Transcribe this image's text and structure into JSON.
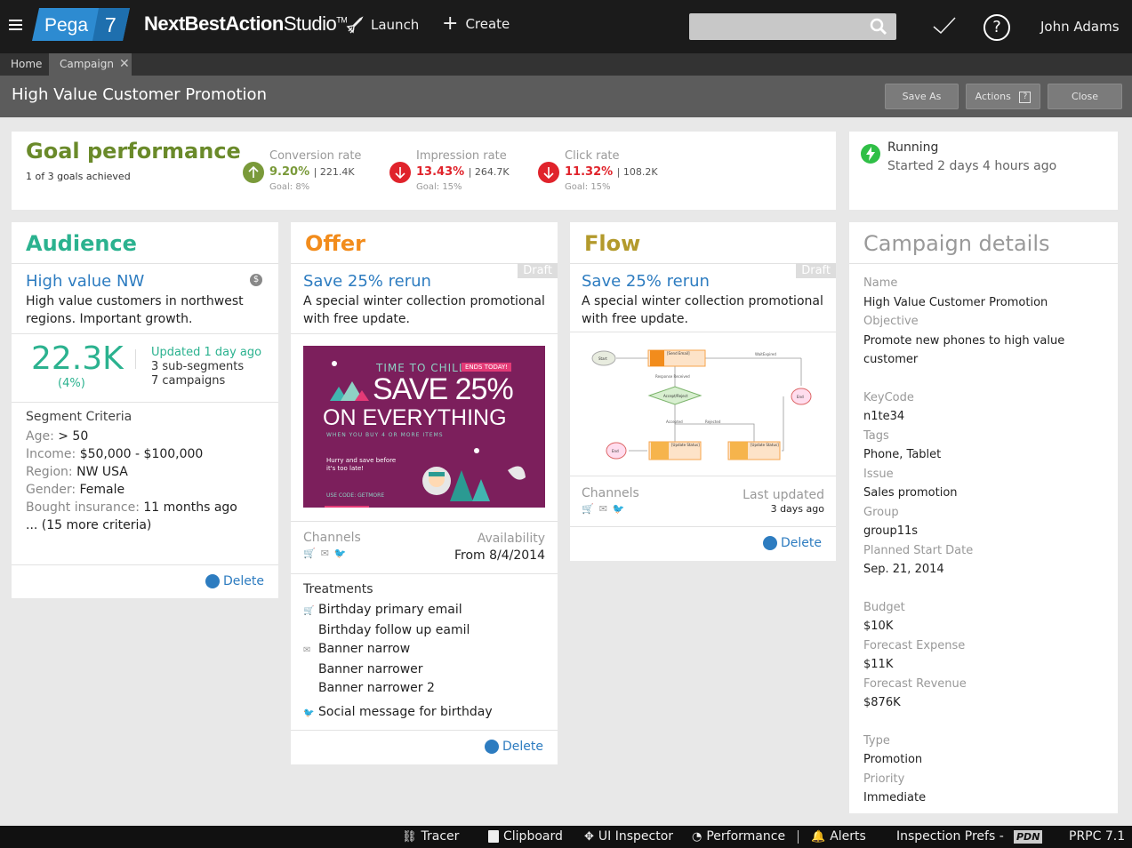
{
  "header": {
    "logo_text": "Pega",
    "logo_version": "7",
    "app_name_bold": "NextBestAction",
    "app_name_light": "Studio",
    "trademark": "TM",
    "launch_label": "Launch",
    "create_label": "Create",
    "search_placeholder": "",
    "user_name": "John Adams",
    "help_label": "?"
  },
  "tabs": [
    {
      "label": "Home",
      "active": false
    },
    {
      "label": "Campaign",
      "active": true
    }
  ],
  "title_bar": {
    "title": "High Value Customer Promotion",
    "save_as_label": "Save As",
    "actions_label": "Actions",
    "close_label": "Close"
  },
  "goal_performance": {
    "title": "Goal performance",
    "subtitle": "1 of 3 goals achieved",
    "metrics": [
      {
        "label": "Conversion rate",
        "value": "9.20%",
        "count": "| 221.4K",
        "goal": "Goal: 8%",
        "trend": "up",
        "color": "#7a9a3a"
      },
      {
        "label": "Impression rate",
        "value": "13.43%",
        "count": "| 264.7K",
        "goal": "Goal: 15%",
        "trend": "down",
        "color": "#e0232b"
      },
      {
        "label": "Click rate",
        "value": "11.32%",
        "count": "| 108.2K",
        "goal": "Goal: 15%",
        "trend": "down",
        "color": "#e0232b"
      }
    ]
  },
  "status": {
    "state": "Running",
    "started": "Started 2 days 4 hours ago"
  },
  "audience": {
    "title": "Audience",
    "segment_name": "High value NW",
    "segment_desc": "High value customers in northwest regions. Important growth.",
    "count": "22.3K",
    "percent": "(4%)",
    "updated": "Updated 1 day ago",
    "sub_segments": "3 sub-segments",
    "campaigns": "7 campaigns",
    "criteria_title": "Segment Criteria",
    "criteria": [
      {
        "label": "Age:",
        "value": "> 50"
      },
      {
        "label": "Income:",
        "value": "$50,000 - $100,000"
      },
      {
        "label": "Region:",
        "value": "NW USA"
      },
      {
        "label": "Gender:",
        "value": "Female"
      },
      {
        "label": "Bought insurance:",
        "value": "11 months ago"
      }
    ],
    "more_criteria": "... (15 more criteria)",
    "delete_label": "Delete"
  },
  "offer": {
    "title": "Offer",
    "draft_label": "Draft",
    "name": "Save 25% rerun",
    "desc": "A special winter collection promotional with free update.",
    "banner": {
      "tagline": "TIME TO CHILL",
      "badge": "ENDS TODAY!",
      "headline1": "SAVE 25%",
      "headline2": "ON EVERYTHING",
      "sub": "WHEN YOU BUY 4 OR MORE ITEMS",
      "note1": "Hurry and save before",
      "note2": "it's too late!",
      "code": "USE CODE: GETMORE"
    },
    "channels_label": "Channels",
    "availability_label": "Availability",
    "availability_value": "From 8/4/2014",
    "treatments_label": "Treatments",
    "treatments": [
      {
        "label": "Birthday primary email",
        "icon": "cart-icon"
      },
      {
        "label": "Birthday follow up eamil",
        "icon": ""
      },
      {
        "label": "Banner narrow",
        "icon": "email-icon"
      },
      {
        "label": "Banner narrower",
        "icon": ""
      },
      {
        "label": "Banner narrower 2",
        "icon": ""
      },
      {
        "label": "Social message for birthday",
        "icon": "twitter-icon"
      }
    ],
    "delete_label": "Delete"
  },
  "flow": {
    "title": "Flow",
    "draft_label": "Draft",
    "name": "Save 25% rerun",
    "desc": "A special winter collection promotional with free update.",
    "diagram": {
      "start": "Start",
      "send_email": "[Send Email]",
      "wait_expired": "WaitExpired",
      "response_received": "Response Received",
      "accept_reject": "Accept/Reject",
      "accepted": "Accepted",
      "rejected": "Rejected",
      "end": "End",
      "update_status": "[Update Status]"
    },
    "channels_label": "Channels",
    "last_updated_label": "Last updated",
    "last_updated_value": "3 days ago",
    "delete_label": "Delete"
  },
  "details": {
    "title": "Campaign details",
    "fields": [
      {
        "label": "Name",
        "value": "High Value Customer Promotion"
      },
      {
        "label": "Objective",
        "value": "Promote new phones to high value customer"
      },
      {
        "label": "KeyCode",
        "value": "n1te34"
      },
      {
        "label": "Tags",
        "value": "Phone, Tablet"
      },
      {
        "label": "Issue",
        "value": "Sales promotion"
      },
      {
        "label": "Group",
        "value": "group11s"
      },
      {
        "label": "Planned Start Date",
        "value": "Sep. 21, 2014"
      },
      {
        "label": "Budget",
        "value": "$10K"
      },
      {
        "label": "Forecast Expense",
        "value": "$11K"
      },
      {
        "label": "Forecast Revenue",
        "value": "$876K"
      },
      {
        "label": "Type",
        "value": "Promotion"
      },
      {
        "label": "Priority",
        "value": "Immediate"
      }
    ]
  },
  "status_bar": {
    "tracer": "Tracer",
    "clipboard": "Clipboard",
    "ui_inspector": "UI Inspector",
    "performance": "Performance",
    "alerts": "Alerts",
    "inspection_prefs": "Inspection Prefs -",
    "pdn": "PDN",
    "version": "PRPC 7.1"
  },
  "colors": {
    "goal_green": "#6a8a2a",
    "audience_teal": "#2bb28f",
    "offer_orange": "#f28c1c",
    "flow_olive": "#b39a2c",
    "link_blue": "#2d7cc0",
    "alert_red": "#e0232b"
  }
}
